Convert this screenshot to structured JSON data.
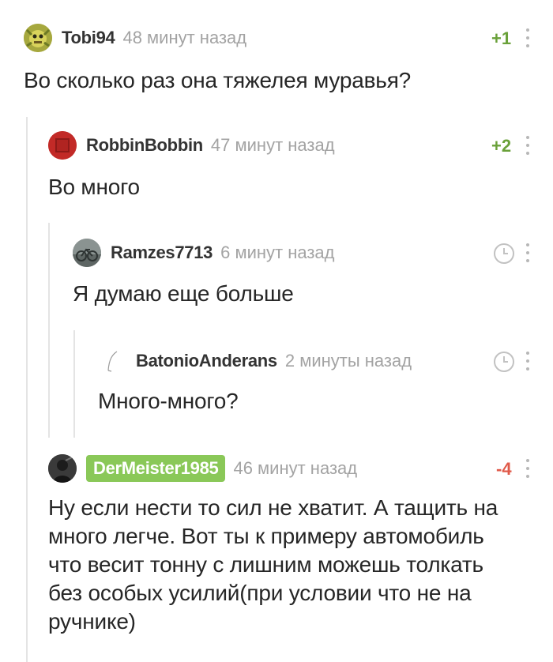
{
  "colors": {
    "positive": "#6aa13a",
    "negative": "#e05a4a",
    "badge": "#8ac858",
    "muted": "#a3a3a3",
    "branch": "#e4e4e4"
  },
  "comments": [
    {
      "username": "Tobi94",
      "time": "48 минут назад",
      "text": "Во сколько раз она тяжелея муравья?",
      "rating": "+1",
      "icon": "more-icon"
    },
    {
      "username": "RobbinBobbin",
      "time": "47 минут назад",
      "text": "Во много",
      "rating": "+2",
      "icon": "more-icon"
    },
    {
      "username": "Ramzes7713",
      "time": "6 минут назад",
      "text": "Я думаю еще больше",
      "rating_icon": "clock-icon",
      "icon": "more-icon"
    },
    {
      "username": "BatonioAnderans",
      "time": "2 минуты назад",
      "text": "Много-много?",
      "rating_icon": "clock-icon",
      "icon": "more-icon"
    },
    {
      "username": "DerMeister1985",
      "time": "46 минут назад",
      "text_lines": [
        "Ну если нести то сил не хватит. А тащить на",
        "много легче. Вот ты к примеру автомобиль",
        "что весит тонну с лишним можешь толкать",
        "без особых усилий(при условии что не на",
        "ручнике)"
      ],
      "rating": "-4",
      "icon": "more-icon"
    }
  ]
}
